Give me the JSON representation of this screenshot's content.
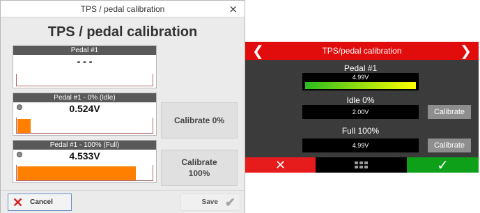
{
  "dialog": {
    "title": "TPS / pedal calibration",
    "close_glyph": "×",
    "heading": "TPS / pedal calibration",
    "panels": [
      {
        "header": "Pedal #1",
        "value": "- - -",
        "level_fraction": 0
      },
      {
        "header": "Pedal #1 - 0% (Idle)",
        "value": "0.524V",
        "level_fraction": 0.11
      },
      {
        "header": "Pedal #1 - 100% (Full)",
        "value": "4.533V",
        "level_fraction": 0.96
      }
    ],
    "calibrate_0": "Calibrate 0%",
    "calibrate_100": "Calibrate 100%",
    "cancel_label": "Cancel",
    "save_label": "Save",
    "colors": {
      "bar": "#ff7f00",
      "panel_header": "#595959",
      "cancel_icon": "#d42020"
    }
  },
  "device": {
    "title": "TPS/pedal calibration",
    "left_arrow": "❮",
    "right_arrow": "❯",
    "pedal_label": "Pedal #1",
    "pedal_value": "4.99V",
    "pedal_level_fraction": 1.0,
    "idle_label": "Idle 0%",
    "idle_value": "2.00V",
    "full_label": "Full 100%",
    "full_value": "4.99V",
    "calibrate_label": "Calibrate",
    "cancel_icon": "close-icon",
    "menu_icon": "grid-icon",
    "ok_icon": "check-icon",
    "colors": {
      "top_bar": "#e10c0c",
      "cancel": "#e61b1b",
      "ok": "#0fa01a",
      "bar_gradient": [
        "#2bbd1f",
        "#ffff00"
      ]
    }
  }
}
